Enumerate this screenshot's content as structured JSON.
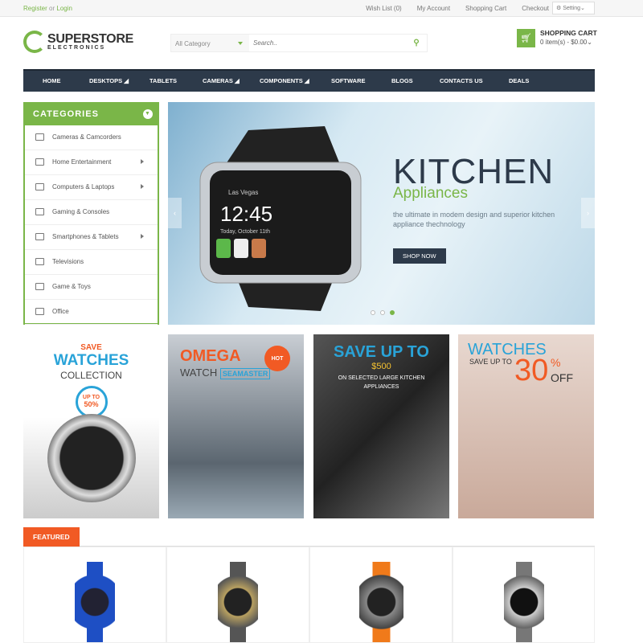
{
  "topbar": {
    "register": "Register",
    "or": "or",
    "login": "Login",
    "links": [
      "Wish List (0)",
      "My Account",
      "Shopping Cart",
      "Checkout"
    ],
    "setting": "Setting"
  },
  "logo": {
    "name": "SUPERSTORE",
    "sub": "ELECTRONICS"
  },
  "search": {
    "category": "All Category",
    "placeholder": "Search.."
  },
  "cart": {
    "title": "SHOPPING CART",
    "summary": "0 item(s) - $0.00"
  },
  "nav": [
    "HOME",
    "DESKTOPS",
    "TABLETS",
    "CAMERAS",
    "COMPONENTS",
    "SOFTWARE",
    "BLOGS",
    "CONTACTS US",
    "DEALS"
  ],
  "categories": {
    "title": "CATEGORIES",
    "items": [
      {
        "label": "Cameras & Camcorders",
        "sub": false
      },
      {
        "label": "Home Entertainment",
        "sub": true
      },
      {
        "label": "Computers & Laptops",
        "sub": true
      },
      {
        "label": "Gaming & Consoles",
        "sub": false
      },
      {
        "label": "Smartphones & Tablets",
        "sub": true
      },
      {
        "label": "Televisions",
        "sub": false
      },
      {
        "label": "Game & Toys",
        "sub": false
      },
      {
        "label": "Office",
        "sub": false
      }
    ]
  },
  "slider": {
    "title": "KITCHEN",
    "subtitle": "Appliances",
    "text": "the ultimate in modem design and superior kitchen appliance thechnology",
    "button": "SHOP NOW",
    "watch_time": "12:45",
    "watch_date": "Today, October 11th",
    "watch_place": "Las Vegas",
    "active_dot": 3
  },
  "banners": [
    {
      "save": "SAVE",
      "title": "WATCHES",
      "sub": "COLLECTION",
      "badge1": "UP TO",
      "badge2": "50%"
    },
    {
      "title": "OMEGA",
      "watch": "WATCH",
      "model": "SEAMASTER",
      "hot": "HOT"
    },
    {
      "title": "SAVE UP TO",
      "amount": "$500",
      "text": "ON SELECTED LARGE KITCHEN APPLIANCES"
    },
    {
      "title": "WATCHES",
      "save": "SAVE UP TO",
      "pct": "30",
      "sym": "%",
      "off": "OFF"
    }
  ],
  "featured": {
    "label": "FEATURED"
  },
  "colors": {
    "accent": "#7ab648",
    "nav": "#2d3a4a",
    "featured": "#f15a24"
  }
}
